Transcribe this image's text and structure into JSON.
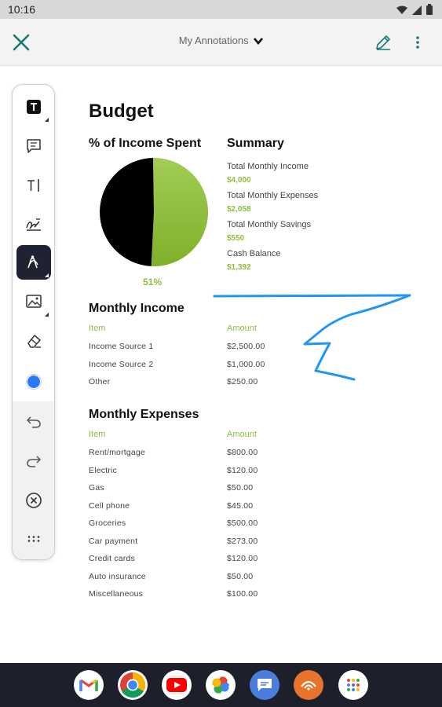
{
  "status_bar": {
    "time": "10:16"
  },
  "app_bar": {
    "title": "My Annotations"
  },
  "toolbar": {
    "tools": [
      "text-box",
      "comment",
      "free-text",
      "signature",
      "pen",
      "image",
      "eraser",
      "color",
      "undo",
      "redo",
      "clear",
      "more"
    ],
    "active_tool": "pen",
    "selected_color": "#2979ff"
  },
  "document": {
    "title": "Budget",
    "pie_section": {
      "heading": "% of Income Spent",
      "percent_label": "51%",
      "chart_data": {
        "type": "pie",
        "values": [
          51,
          49
        ],
        "colors": [
          "#8dbf3f",
          "#000000"
        ]
      }
    },
    "summary": {
      "heading": "Summary",
      "items": [
        {
          "label": "Total Monthly Income",
          "value": "$4,000"
        },
        {
          "label": "Total Monthly Expenses",
          "value": "$2,058"
        },
        {
          "label": "Total Monthly Savings",
          "value": "$550"
        },
        {
          "label": "Cash Balance",
          "value": "$1,392"
        }
      ]
    },
    "income": {
      "heading": "Monthly Income",
      "col_item": "Item",
      "col_amount": "Amount",
      "rows": [
        {
          "item": "Income Source 1",
          "amount": "$2,500.00"
        },
        {
          "item": "Income Source 2",
          "amount": "$1,000.00"
        },
        {
          "item": "Other",
          "amount": "$250.00"
        }
      ]
    },
    "expenses": {
      "heading": "Monthly Expenses",
      "col_item": "Item",
      "col_amount": "Amount",
      "rows": [
        {
          "item": "Rent/mortgage",
          "amount": "$800.00"
        },
        {
          "item": "Electric",
          "amount": "$120.00"
        },
        {
          "item": "Gas",
          "amount": "$50.00"
        },
        {
          "item": "Cell phone",
          "amount": "$45.00"
        },
        {
          "item": "Groceries",
          "amount": "$500.00"
        },
        {
          "item": "Car payment",
          "amount": "$273.00"
        },
        {
          "item": "Credit cards",
          "amount": "$120.00"
        },
        {
          "item": "Auto insurance",
          "amount": "$50.00"
        },
        {
          "item": "Miscellaneous",
          "amount": "$100.00"
        }
      ]
    }
  },
  "annotation": {
    "stroke_color": "#2196f3"
  },
  "dock": {
    "apps": [
      "gmail-icon",
      "chrome-icon",
      "youtube-icon",
      "photos-icon",
      "messages-icon",
      "orange-app-icon",
      "app-drawer-icon"
    ]
  }
}
